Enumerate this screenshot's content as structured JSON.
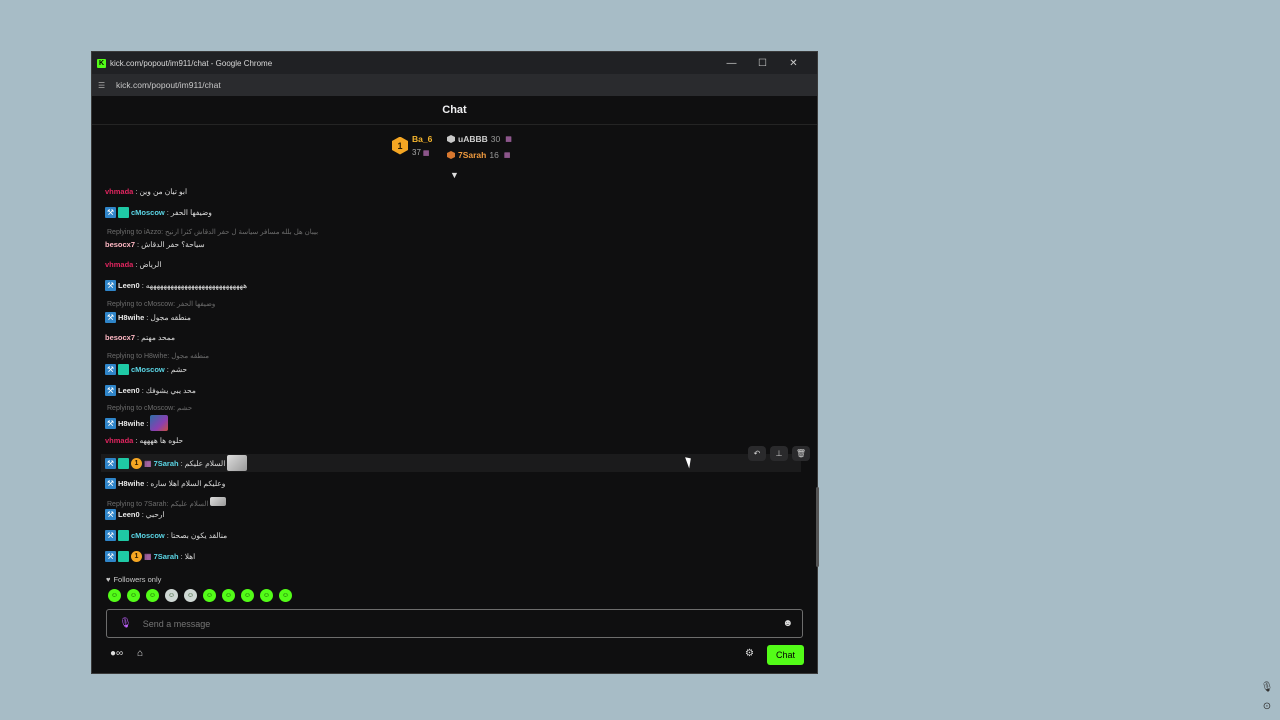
{
  "window": {
    "title": "kick.com/popout/im911/chat - Google Chrome",
    "url": "kick.com/popout/im911/chat",
    "icon": "kick-logo-icon"
  },
  "chat": {
    "header": "Chat"
  },
  "leaderboard": {
    "first": {
      "rank": "1",
      "name": "Ba_6",
      "count": "37"
    },
    "second": {
      "name": "uABBB",
      "count": "30"
    },
    "third": {
      "name": "7Sarah",
      "count": "16"
    }
  },
  "messages": [
    {
      "user": "vhmada",
      "text": "ابو تيان من وين"
    },
    {
      "user": "cMoscow",
      "text": "وضيفها الحفر"
    },
    {
      "reply_to": "Replying to iAzzo: بيبان هل بلله مسافر سياسة ل حفر الدقاش كثرا ارنيح"
    },
    {
      "user": "besocx7",
      "text": "سياحة؟ حفر الدقاش"
    },
    {
      "user": "vhmada",
      "text": "الرياض"
    },
    {
      "user": "Leen0",
      "text": "ههههههههههههههههههههههههههههه"
    },
    {
      "reply_to": "Replying to cMoscow: وضيفها الحفر"
    },
    {
      "user": "H8wihe",
      "text": "منطقه مجول"
    },
    {
      "user": "besocx7",
      "text": "ممحد مهتم"
    },
    {
      "reply_to": "Replying to H8wihe: منطقه مجول"
    },
    {
      "user": "cMoscow",
      "text": "حشم"
    },
    {
      "user": "Leen0",
      "text": "محد يبي يشوفك"
    },
    {
      "reply_to": "Replying to cMoscow: حشم"
    },
    {
      "user": "H8wihe",
      "text": ""
    },
    {
      "user": "vhmada",
      "text": "حلوه ها ههههه"
    },
    {
      "user": "7Sarah",
      "text": "السلام عليكم"
    },
    {
      "user": "H8wihe",
      "text": "وعليكم السلام اهلا ساره"
    },
    {
      "reply_to": "Replying to 7Sarah: السلام عليكم"
    },
    {
      "user": "Leen0",
      "text": "ارحبي"
    },
    {
      "user": "cMoscow",
      "text": "منالقد يكون بصحتا"
    },
    {
      "user": "7Sarah",
      "text": "اهلا"
    }
  ],
  "followers_label": "Followers only",
  "input": {
    "placeholder": "Send a message"
  },
  "send_button": "Chat",
  "colors": {
    "accent": "#53fc18",
    "background": "#0f0f10",
    "desktop": "#a7bcc6"
  }
}
